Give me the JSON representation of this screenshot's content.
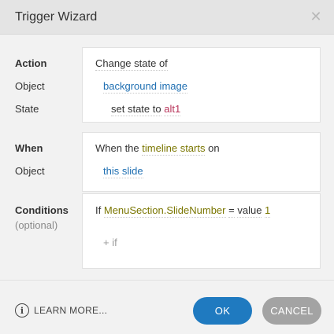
{
  "window": {
    "title": "Trigger Wizard",
    "close_glyph": "✕"
  },
  "action_section": {
    "labels": {
      "action": "Action",
      "object": "Object",
      "state": "State"
    },
    "line1": "Change state of",
    "object_value": "background image",
    "state_prefix": "set state to",
    "state_value": "alt1"
  },
  "when_section": {
    "labels": {
      "when": "When",
      "object": "Object"
    },
    "prefix": "When the",
    "event": "timeline starts",
    "suffix": "on",
    "object_value": "this slide"
  },
  "conditions_section": {
    "labels": {
      "conditions": "Conditions",
      "optional": "(optional)"
    },
    "if_word": "If",
    "variable": "MenuSection.SlideNumber",
    "operator": "=",
    "value_word": "value",
    "value": "1",
    "add_if": "+ if"
  },
  "footer": {
    "info_glyph": "i",
    "learn_more": "LEARN MORE...",
    "ok": "OK",
    "cancel": "CANCEL"
  },
  "colors": {
    "accent": "#1f7ac0",
    "link_blue": "#1f6fb2",
    "olive": "#7a7600",
    "pink": "#b8345a"
  }
}
